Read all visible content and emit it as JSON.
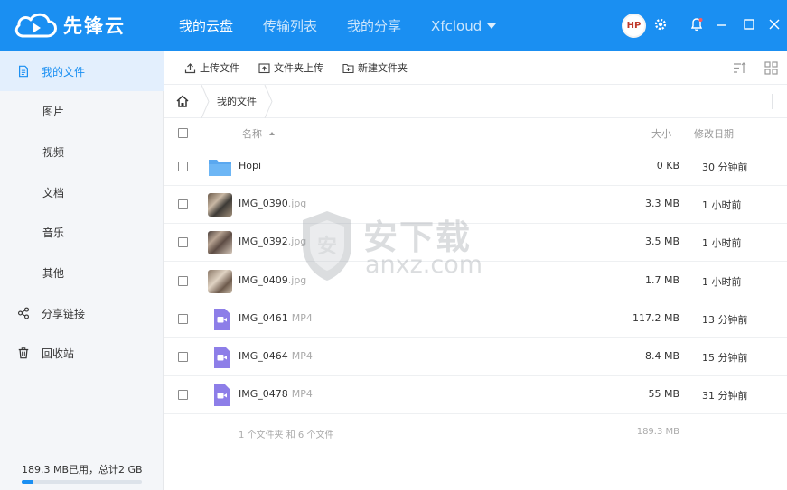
{
  "app": {
    "name": "先锋云"
  },
  "nav": {
    "items": [
      {
        "label": "我的云盘",
        "active": true
      },
      {
        "label": "传输列表",
        "active": false
      },
      {
        "label": "我的分享",
        "active": false
      },
      {
        "label": "Xfcloud",
        "active": false,
        "dropdown": true
      }
    ]
  },
  "user": {
    "avatar_text": "HP"
  },
  "sidebar": {
    "items": [
      {
        "label": "我的文件",
        "icon": "file-icon",
        "active": true
      },
      {
        "label": "图片",
        "sub": true
      },
      {
        "label": "视频",
        "sub": true
      },
      {
        "label": "文档",
        "sub": true
      },
      {
        "label": "音乐",
        "sub": true
      },
      {
        "label": "其他",
        "sub": true
      },
      {
        "label": "分享链接",
        "icon": "share-icon"
      },
      {
        "label": "回收站",
        "icon": "trash-icon"
      }
    ],
    "storage_text": "189.3 MB已用，总计2 GB",
    "storage_fraction": 0.092
  },
  "toolbar": {
    "upload_file": "上传文件",
    "upload_folder": "文件夹上传",
    "new_folder": "新建文件夹"
  },
  "breadcrumb": {
    "current": "我的文件"
  },
  "list": {
    "headers": {
      "name": "名称",
      "size": "大小",
      "date": "修改日期"
    },
    "rows": [
      {
        "name": "Hopi",
        "ext": "",
        "size": "0 KB",
        "date": "30 分钟前",
        "kind": "folder"
      },
      {
        "name": "IMG_0390",
        "ext": ".jpg",
        "size": "3.3 MB",
        "date": "1 小时前",
        "kind": "image"
      },
      {
        "name": "IMG_0392",
        "ext": ".jpg",
        "size": "3.5 MB",
        "date": "1 小时前",
        "kind": "image"
      },
      {
        "name": "IMG_0409",
        "ext": ".jpg",
        "size": "1.7 MB",
        "date": "1 小时前",
        "kind": "image"
      },
      {
        "name": "IMG_0461",
        "ext": "MP4",
        "size": "117.2 MB",
        "date": "13 分钟前",
        "kind": "video"
      },
      {
        "name": "IMG_0464",
        "ext": "MP4",
        "size": "8.4 MB",
        "date": "15 分钟前",
        "kind": "video"
      },
      {
        "name": "IMG_0478",
        "ext": "MP4",
        "size": "55 MB",
        "date": "31 分钟前",
        "kind": "video"
      }
    ],
    "summary_text": "1 个文件夹 和 6 个文件",
    "summary_size": "189.3 MB"
  },
  "watermark": {
    "title": "安下载",
    "domain": "anxz.com",
    "shield_letter": "安"
  },
  "colors": {
    "accent": "#1a8ff2",
    "folder": "#5aa8f0",
    "video": "#8d7ee8"
  }
}
